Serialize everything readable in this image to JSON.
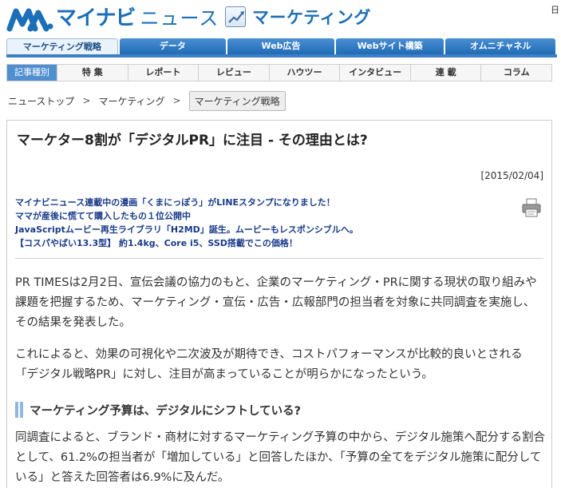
{
  "header": {
    "logo_text": "マイナビ",
    "logo_news": "ニュース",
    "section_title": "マーケティング",
    "right_text": "日"
  },
  "main_tabs": [
    {
      "label": "マーケティング戦略",
      "active": true
    },
    {
      "label": "データ",
      "active": false
    },
    {
      "label": "Web広告",
      "active": false
    },
    {
      "label": "Webサイト構築",
      "active": false
    },
    {
      "label": "オムニチャネル",
      "active": false
    }
  ],
  "sub_nav": {
    "label": "記事種別",
    "items": [
      "特 集",
      "レポート",
      "レビュー",
      "ハウツー",
      "インタビュー",
      "連 載",
      "コラム"
    ]
  },
  "breadcrumb": {
    "home": "ニューストップ",
    "section": "マーケティング",
    "current": "マーケティング戦略",
    "separator": ">"
  },
  "article": {
    "title": "マーケター8割が「デジタルPR」に注目 - その理由とは?",
    "date": "[2015/02/04]",
    "news_links": [
      "マイナビニュース連載中の漫画「くまにっぽう」がLINEスタンプになりました！",
      "ママが産後に慌てて購入したもの１位公開中",
      "JavaScriptムービー再生ライブラリ「H2MD」誕生。ムービーもレスポンシブルへ。",
      "【コスパやばい13.3型】 約1.4kg、Core i5、SSD搭載でこの価格！"
    ],
    "paragraph1": "PR TIMESは2月2日、宣伝会議の協力のもと、企業のマーケティング・PRに関する現状の取り組みや課題を把握するため、マーケティング・宣伝・広告・広報部門の担当者を対象に共同調査を実施し、その結果を発表した。",
    "paragraph2": "これによると、効果の可視化や二次波及が期待でき、コストパフォーマンスが比較的良いとされる「デジタル戦略PR」に対し、注目が高まっていることが明らかになったという。",
    "subheading": "マーケティング予算は、デジタルにシフトしている?",
    "paragraph3": "同調査によると、ブランド・商材に対するマーケティング予算の中から、デジタル施策へ配分する割合として、61.2%の担当者が「増加している」と回答したほか、「予算の全てをデジタル施策に配分している」と答えた回答者は6.9%に及んだ。"
  },
  "colors": {
    "brand_blue": "#1b6fb8",
    "tab_blue": "#3d7fc6",
    "link_navy": "#1a3b8a"
  }
}
